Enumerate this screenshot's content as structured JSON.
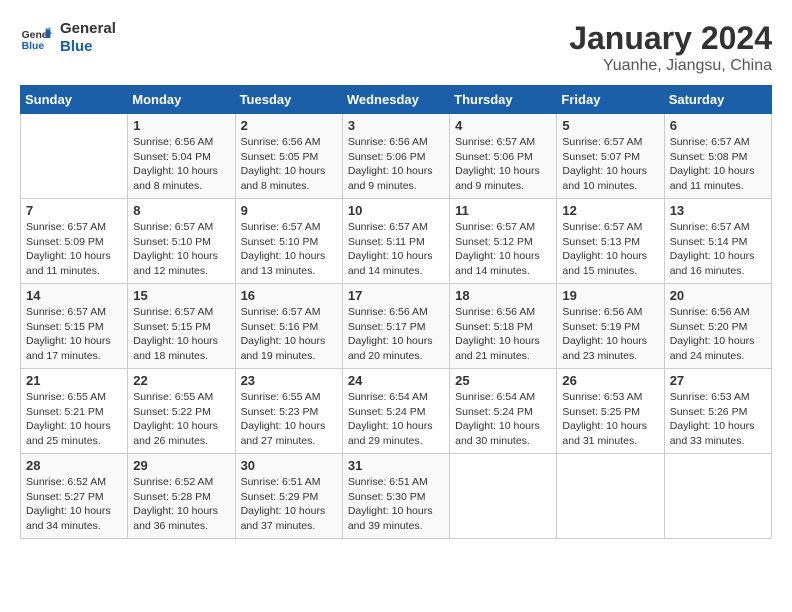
{
  "logo": {
    "line1": "General",
    "line2": "Blue"
  },
  "title": "January 2024",
  "location": "Yuanhe, Jiangsu, China",
  "weekdays": [
    "Sunday",
    "Monday",
    "Tuesday",
    "Wednesday",
    "Thursday",
    "Friday",
    "Saturday"
  ],
  "weeks": [
    [
      {
        "day": "",
        "info": ""
      },
      {
        "day": "1",
        "info": "Sunrise: 6:56 AM\nSunset: 5:04 PM\nDaylight: 10 hours\nand 8 minutes."
      },
      {
        "day": "2",
        "info": "Sunrise: 6:56 AM\nSunset: 5:05 PM\nDaylight: 10 hours\nand 8 minutes."
      },
      {
        "day": "3",
        "info": "Sunrise: 6:56 AM\nSunset: 5:06 PM\nDaylight: 10 hours\nand 9 minutes."
      },
      {
        "day": "4",
        "info": "Sunrise: 6:57 AM\nSunset: 5:06 PM\nDaylight: 10 hours\nand 9 minutes."
      },
      {
        "day": "5",
        "info": "Sunrise: 6:57 AM\nSunset: 5:07 PM\nDaylight: 10 hours\nand 10 minutes."
      },
      {
        "day": "6",
        "info": "Sunrise: 6:57 AM\nSunset: 5:08 PM\nDaylight: 10 hours\nand 11 minutes."
      }
    ],
    [
      {
        "day": "7",
        "info": "Sunrise: 6:57 AM\nSunset: 5:09 PM\nDaylight: 10 hours\nand 11 minutes."
      },
      {
        "day": "8",
        "info": "Sunrise: 6:57 AM\nSunset: 5:10 PM\nDaylight: 10 hours\nand 12 minutes."
      },
      {
        "day": "9",
        "info": "Sunrise: 6:57 AM\nSunset: 5:10 PM\nDaylight: 10 hours\nand 13 minutes."
      },
      {
        "day": "10",
        "info": "Sunrise: 6:57 AM\nSunset: 5:11 PM\nDaylight: 10 hours\nand 14 minutes."
      },
      {
        "day": "11",
        "info": "Sunrise: 6:57 AM\nSunset: 5:12 PM\nDaylight: 10 hours\nand 14 minutes."
      },
      {
        "day": "12",
        "info": "Sunrise: 6:57 AM\nSunset: 5:13 PM\nDaylight: 10 hours\nand 15 minutes."
      },
      {
        "day": "13",
        "info": "Sunrise: 6:57 AM\nSunset: 5:14 PM\nDaylight: 10 hours\nand 16 minutes."
      }
    ],
    [
      {
        "day": "14",
        "info": "Sunrise: 6:57 AM\nSunset: 5:15 PM\nDaylight: 10 hours\nand 17 minutes."
      },
      {
        "day": "15",
        "info": "Sunrise: 6:57 AM\nSunset: 5:15 PM\nDaylight: 10 hours\nand 18 minutes."
      },
      {
        "day": "16",
        "info": "Sunrise: 6:57 AM\nSunset: 5:16 PM\nDaylight: 10 hours\nand 19 minutes."
      },
      {
        "day": "17",
        "info": "Sunrise: 6:56 AM\nSunset: 5:17 PM\nDaylight: 10 hours\nand 20 minutes."
      },
      {
        "day": "18",
        "info": "Sunrise: 6:56 AM\nSunset: 5:18 PM\nDaylight: 10 hours\nand 21 minutes."
      },
      {
        "day": "19",
        "info": "Sunrise: 6:56 AM\nSunset: 5:19 PM\nDaylight: 10 hours\nand 23 minutes."
      },
      {
        "day": "20",
        "info": "Sunrise: 6:56 AM\nSunset: 5:20 PM\nDaylight: 10 hours\nand 24 minutes."
      }
    ],
    [
      {
        "day": "21",
        "info": "Sunrise: 6:55 AM\nSunset: 5:21 PM\nDaylight: 10 hours\nand 25 minutes."
      },
      {
        "day": "22",
        "info": "Sunrise: 6:55 AM\nSunset: 5:22 PM\nDaylight: 10 hours\nand 26 minutes."
      },
      {
        "day": "23",
        "info": "Sunrise: 6:55 AM\nSunset: 5:23 PM\nDaylight: 10 hours\nand 27 minutes."
      },
      {
        "day": "24",
        "info": "Sunrise: 6:54 AM\nSunset: 5:24 PM\nDaylight: 10 hours\nand 29 minutes."
      },
      {
        "day": "25",
        "info": "Sunrise: 6:54 AM\nSunset: 5:24 PM\nDaylight: 10 hours\nand 30 minutes."
      },
      {
        "day": "26",
        "info": "Sunrise: 6:53 AM\nSunset: 5:25 PM\nDaylight: 10 hours\nand 31 minutes."
      },
      {
        "day": "27",
        "info": "Sunrise: 6:53 AM\nSunset: 5:26 PM\nDaylight: 10 hours\nand 33 minutes."
      }
    ],
    [
      {
        "day": "28",
        "info": "Sunrise: 6:52 AM\nSunset: 5:27 PM\nDaylight: 10 hours\nand 34 minutes."
      },
      {
        "day": "29",
        "info": "Sunrise: 6:52 AM\nSunset: 5:28 PM\nDaylight: 10 hours\nand 36 minutes."
      },
      {
        "day": "30",
        "info": "Sunrise: 6:51 AM\nSunset: 5:29 PM\nDaylight: 10 hours\nand 37 minutes."
      },
      {
        "day": "31",
        "info": "Sunrise: 6:51 AM\nSunset: 5:30 PM\nDaylight: 10 hours\nand 39 minutes."
      },
      {
        "day": "",
        "info": ""
      },
      {
        "day": "",
        "info": ""
      },
      {
        "day": "",
        "info": ""
      }
    ]
  ]
}
